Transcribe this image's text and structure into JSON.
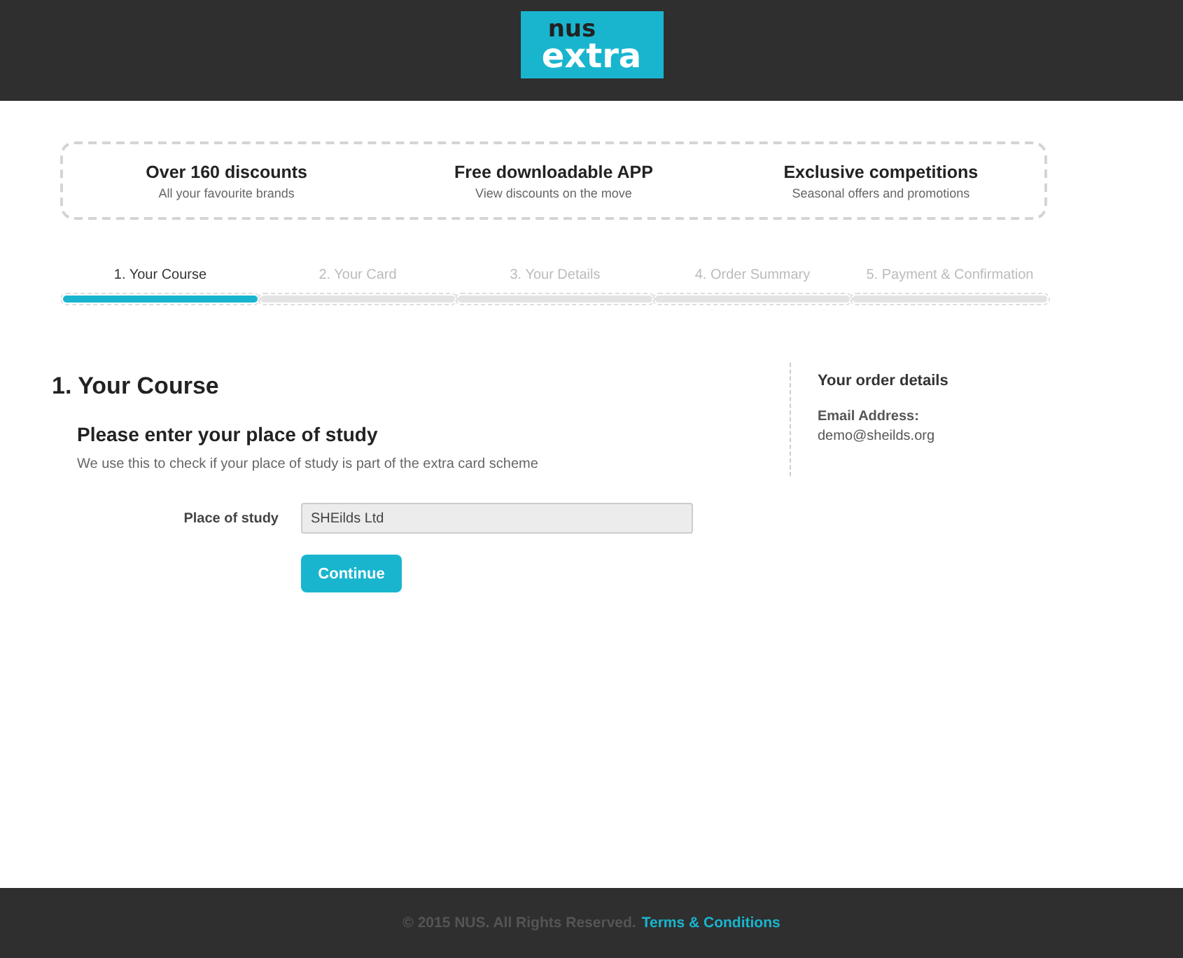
{
  "logo": {
    "top": "nus",
    "bottom": "extra"
  },
  "benefits": [
    {
      "title": "Over 160 discounts",
      "subtitle": "All your favourite brands"
    },
    {
      "title": "Free downloadable APP",
      "subtitle": "View discounts on the move"
    },
    {
      "title": "Exclusive competitions",
      "subtitle": "Seasonal offers and promotions"
    }
  ],
  "steps": [
    {
      "label": "1. Your Course",
      "selected": true
    },
    {
      "label": "2. Your Card",
      "selected": false
    },
    {
      "label": "3. Your Details",
      "selected": false
    },
    {
      "label": "4. Order Summary",
      "selected": false
    },
    {
      "label": "5. Payment & Confirmation",
      "selected": false
    }
  ],
  "section": {
    "title": "1. Your Course",
    "heading": "Please enter your place of study",
    "description": "We use this to check if your place of study is part of the extra card scheme",
    "field_label": "Place of study",
    "field_value": "SHEilds Ltd",
    "button": "Continue"
  },
  "order_details": {
    "title": "Your order details",
    "label": "Email Address:",
    "value": "demo@sheilds.org"
  },
  "footer": {
    "copyright": "© 2015 NUS. All Rights Reserved.",
    "link": "Terms & Conditions"
  }
}
